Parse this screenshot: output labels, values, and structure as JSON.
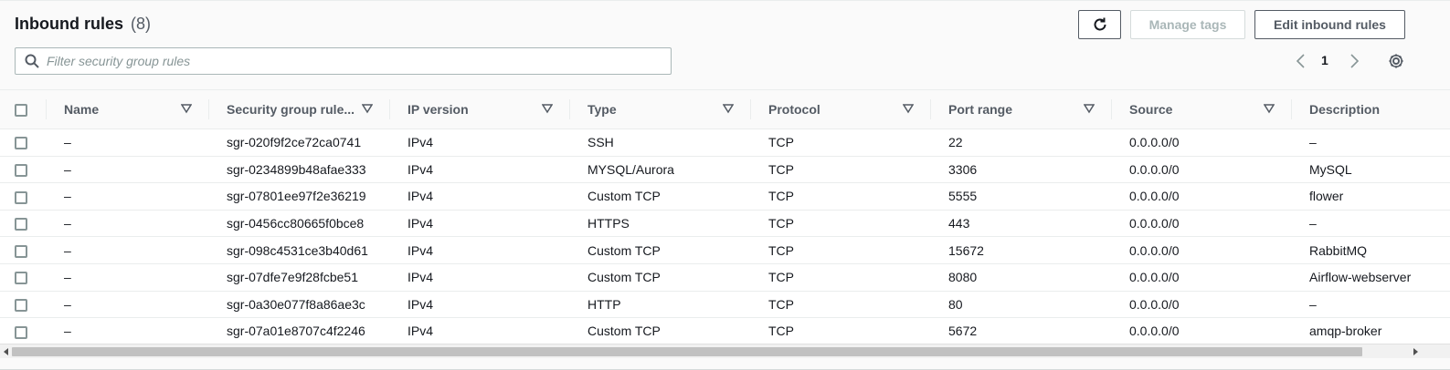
{
  "header": {
    "title": "Inbound rules",
    "count": "(8)",
    "manage_tags_label": "Manage tags",
    "edit_rules_label": "Edit inbound rules"
  },
  "filter": {
    "placeholder": "Filter security group rules",
    "value": ""
  },
  "pagination": {
    "current_page": "1"
  },
  "icons": {
    "refresh": "refresh-icon",
    "search": "search-icon",
    "prev": "chevron-left-icon",
    "next": "chevron-right-icon",
    "settings": "gear-icon",
    "sort": "sort-caret-icon"
  },
  "colors": {
    "text": "#16191f",
    "muted": "#545b64",
    "border": "#eaeded",
    "disabled": "#aab7b8"
  },
  "table": {
    "columns": [
      "Name",
      "Security group rule...",
      "IP version",
      "Type",
      "Protocol",
      "Port range",
      "Source",
      "Description"
    ],
    "rows": [
      [
        "–",
        "sgr-020f9f2ce72ca0741",
        "IPv4",
        "SSH",
        "TCP",
        "22",
        "0.0.0.0/0",
        "–"
      ],
      [
        "–",
        "sgr-0234899b48afae333",
        "IPv4",
        "MYSQL/Aurora",
        "TCP",
        "3306",
        "0.0.0.0/0",
        "MySQL"
      ],
      [
        "–",
        "sgr-07801ee97f2e36219",
        "IPv4",
        "Custom TCP",
        "TCP",
        "5555",
        "0.0.0.0/0",
        "flower"
      ],
      [
        "–",
        "sgr-0456cc80665f0bce8",
        "IPv4",
        "HTTPS",
        "TCP",
        "443",
        "0.0.0.0/0",
        "–"
      ],
      [
        "–",
        "sgr-098c4531ce3b40d61",
        "IPv4",
        "Custom TCP",
        "TCP",
        "15672",
        "0.0.0.0/0",
        "RabbitMQ"
      ],
      [
        "–",
        "sgr-07dfe7e9f28fcbe51",
        "IPv4",
        "Custom TCP",
        "TCP",
        "8080",
        "0.0.0.0/0",
        "Airflow-webserver"
      ],
      [
        "–",
        "sgr-0a30e077f8a86ae3c",
        "IPv4",
        "HTTP",
        "TCP",
        "80",
        "0.0.0.0/0",
        "–"
      ],
      [
        "–",
        "sgr-07a01e8707c4f2246",
        "IPv4",
        "Custom TCP",
        "TCP",
        "5672",
        "0.0.0.0/0",
        "amqp-broker"
      ]
    ]
  }
}
